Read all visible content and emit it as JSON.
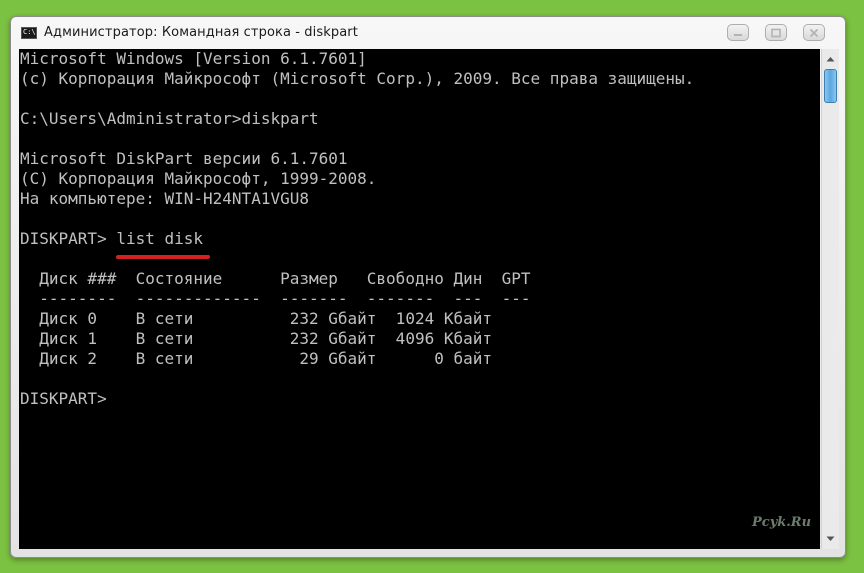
{
  "window": {
    "title": "Администратор: Командная строка - diskpart",
    "icon_text": "C:\\",
    "icon": "console-icon",
    "buttons": [
      "minimize-icon",
      "maximize-icon",
      "close-icon"
    ]
  },
  "console": {
    "lines": [
      "Microsoft Windows [Version 6.1.7601]",
      "(c) Корпорация Майкрософт (Microsoft Corp.), 2009. Все права защищены.",
      "",
      "C:\\Users\\Administrator>diskpart",
      "",
      "Microsoft DiskPart версии 6.1.7601",
      "(C) Корпорация Майкрософт, 1999-2008.",
      "На компьютере: WIN-H24NTA1VGU8",
      "",
      "DISKPART> list disk",
      "",
      "  Диск ###  Состояние      Размер   Свободно Дин  GPT",
      "  --------  -------------  -------  -------  ---  ---",
      "  Диск 0    В сети          232 Gбайт  1024 Kбайт",
      "  Диск 1    В сети          232 Gбайт  4096 Kбайт",
      "  Диск 2    В сети           29 Gбайт      0 байт",
      "",
      "DISKPART>"
    ],
    "text_color": "#c0c0c0",
    "background": "#000000",
    "highlight_color": "#d42020"
  },
  "watermark": "Pcyk.Ru",
  "colors": {
    "desktop": "#7cc242",
    "scroll_thumb": "#5aa6df"
  }
}
